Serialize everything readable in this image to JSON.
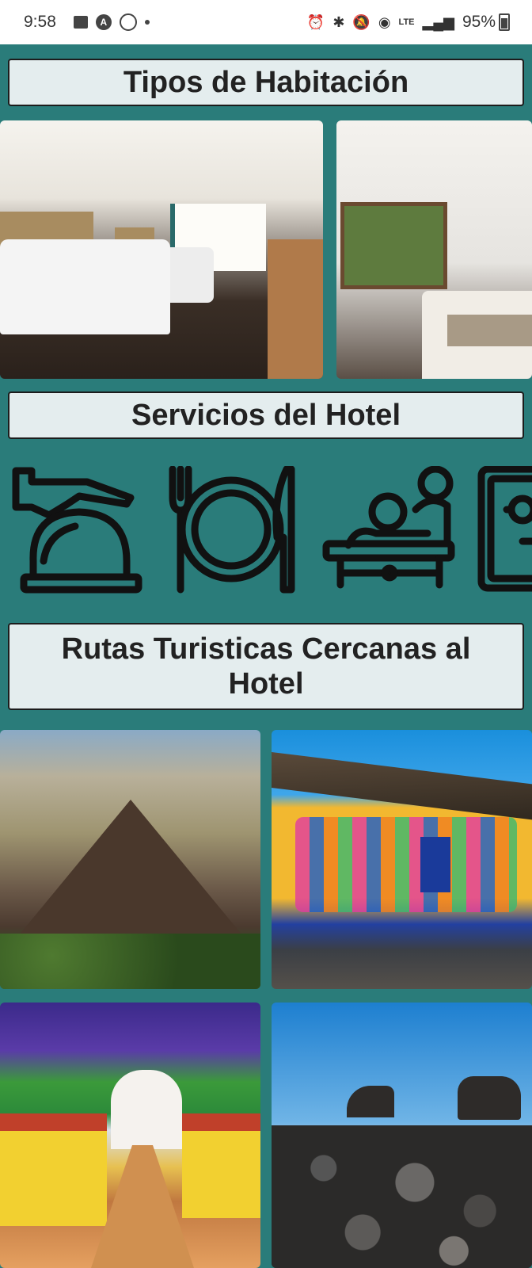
{
  "status_bar": {
    "time": "9:58",
    "battery": "95%",
    "network": "LTE"
  },
  "sections": {
    "rooms_title": "Tipos de Habitación",
    "services_title": "Servicios del Hotel",
    "routes_title": "Rutas Turisticas Cercanas al Hotel"
  },
  "services": {
    "icons": [
      "concierge-bell-icon",
      "dining-icon",
      "massage-spa-icon",
      "safe-box-icon"
    ]
  },
  "colors": {
    "background": "#2a7c7a",
    "title_box": "#e4edee"
  }
}
